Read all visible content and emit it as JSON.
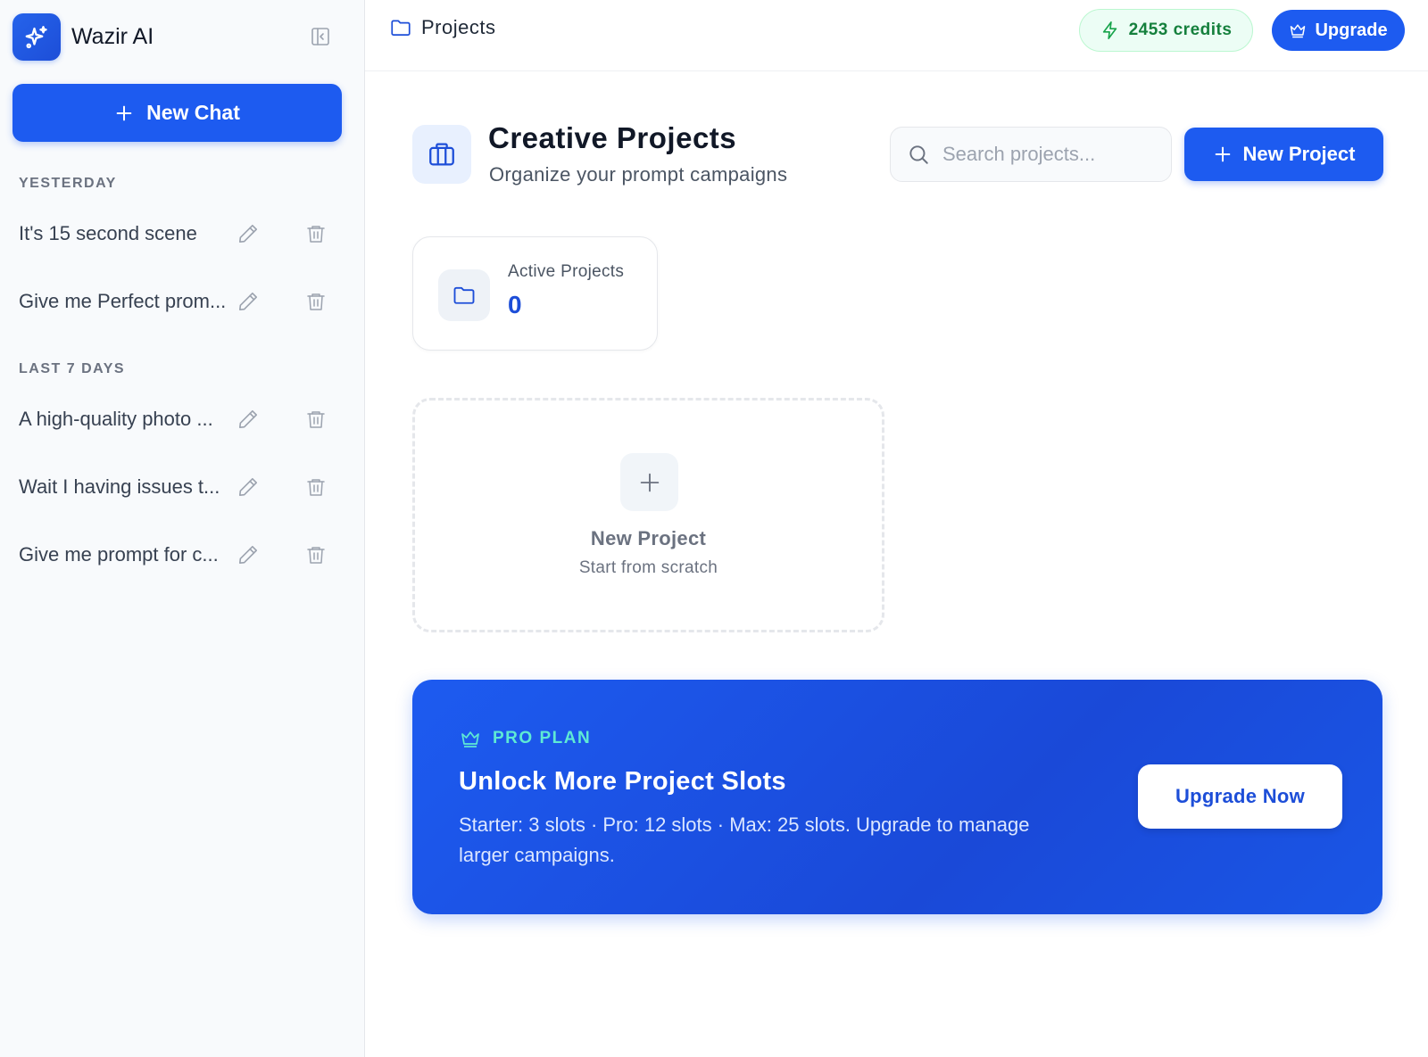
{
  "sidebar": {
    "brand_name": "Wazir AI",
    "new_chat_label": "New Chat",
    "sections": [
      {
        "label": "YESTERDAY",
        "items": [
          {
            "title": "It's 15 second scene"
          },
          {
            "title": "Give me Perfect prom..."
          }
        ]
      },
      {
        "label": "LAST 7 DAYS",
        "items": [
          {
            "title": "A high-quality photo ..."
          },
          {
            "title": "Wait I having issues t..."
          },
          {
            "title": "Give me prompt for c..."
          }
        ]
      }
    ]
  },
  "topbar": {
    "breadcrumb": "Projects",
    "credits": "2453 credits",
    "upgrade_label": "Upgrade"
  },
  "header": {
    "title": "Creative Projects",
    "subtitle": "Organize your prompt campaigns",
    "search_placeholder": "Search projects...",
    "new_project_label": "New Project"
  },
  "stats": {
    "label": "Active Projects",
    "value": "0"
  },
  "new_card": {
    "title": "New Project",
    "subtitle": "Start from scratch"
  },
  "promo": {
    "tag": "PRO PLAN",
    "title": "Unlock More Project Slots",
    "description": "Starter: 3 slots · Pro: 12 slots · Max: 25 slots. Upgrade to manage larger campaigns.",
    "button_label": "Upgrade Now"
  },
  "icons": {
    "brand": "sparkles-icon",
    "collapse": "sidebar-collapse-icon",
    "edit": "pencil-icon",
    "delete": "trash-icon",
    "folder": "folder-icon",
    "bolt": "lightning-icon",
    "crown": "crown-icon",
    "briefcase": "briefcase-icon",
    "search": "search-icon",
    "plus": "plus-icon"
  },
  "colors": {
    "accent": "#1d5bf0",
    "credits_green": "#15803d",
    "promo_tag": "#5eead4"
  }
}
